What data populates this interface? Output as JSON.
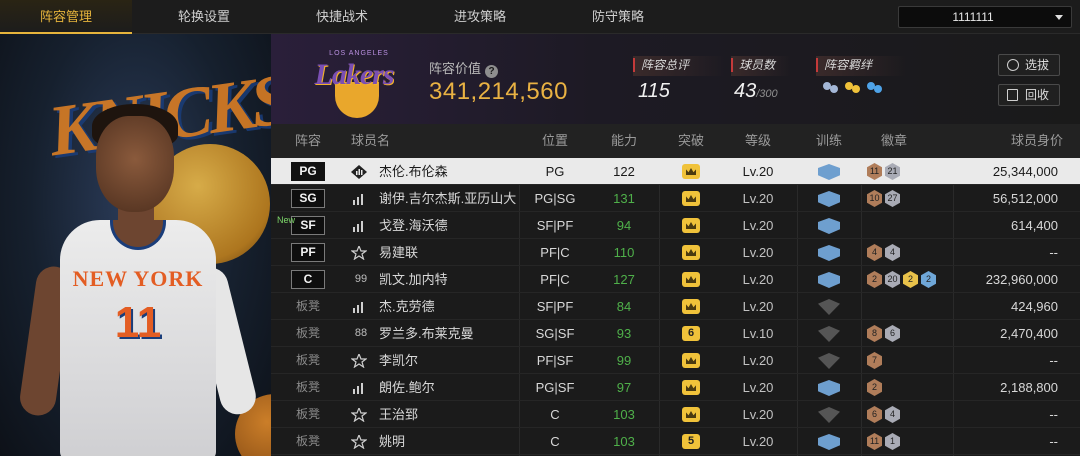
{
  "nav": {
    "tabs": [
      "阵容管理",
      "轮换设置",
      "快捷战术",
      "进攻策略",
      "防守策略"
    ],
    "active_tab": "阵容管理",
    "team_selector": "1111111"
  },
  "colors": {
    "accent": "#e6b43c",
    "value": "#e9b243",
    "green": "#4fb04a"
  },
  "hero": {
    "jersey_text": "NEW YORK",
    "jersey_number": "11",
    "bg_text": "KNICKS"
  },
  "team_header": {
    "logo_text": "Lakers",
    "logo_subtext": "LOS ANGELES",
    "value_label": "阵容价值",
    "value": "341,214,560",
    "stats": [
      {
        "label": "阵容总评",
        "value": "115"
      },
      {
        "label": "球员数",
        "value": "43",
        "sub": "/300"
      },
      {
        "label": "阵容羁绊"
      }
    ],
    "buttons": {
      "select": "选拔",
      "recycle": "回收"
    }
  },
  "table": {
    "headers": [
      "阵容",
      "球员名",
      "位置",
      "能力",
      "突破",
      "等级",
      "训练",
      "徽章",
      "球员身价"
    ],
    "rows": [
      {
        "slot": "PG",
        "starter": true,
        "icon": "diamond",
        "num": "",
        "name": "杰伦.布伦森",
        "position": "PG",
        "rating": "122",
        "breakthrough": "crown",
        "level": "Lv.20",
        "training": "on",
        "badges": [
          {
            "t": "bronze",
            "n": "11"
          },
          {
            "t": "silver",
            "n": "21"
          }
        ],
        "value": "25,344,000"
      },
      {
        "slot": "SG",
        "starter": true,
        "icon": "bars",
        "num": "",
        "name": "谢伊.吉尔杰斯.亚历山大",
        "position": "PG|SG",
        "rating": "131",
        "breakthrough": "crown",
        "level": "Lv.20",
        "training": "on",
        "badges": [
          {
            "t": "bronze",
            "n": "10"
          },
          {
            "t": "silver",
            "n": "27"
          }
        ],
        "value": "56,512,000"
      },
      {
        "slot": "SF",
        "starter": true,
        "new": "New",
        "icon": "bars",
        "num": "",
        "name": "戈登.海沃德",
        "position": "SF|PF",
        "rating": "94",
        "breakthrough": "crown",
        "level": "Lv.20",
        "training": "on",
        "badges": [],
        "value": "614,400"
      },
      {
        "slot": "PF",
        "starter": true,
        "icon": "star",
        "num": "",
        "name": "易建联",
        "position": "PF|C",
        "rating": "110",
        "breakthrough": "crown",
        "level": "Lv.20",
        "training": "on",
        "badges": [
          {
            "t": "bronze",
            "n": "4"
          },
          {
            "t": "silver",
            "n": "4"
          }
        ],
        "value": "--"
      },
      {
        "slot": "C",
        "starter": true,
        "icon": "num",
        "num": "99",
        "name": "凯文.加内特",
        "position": "PF|C",
        "rating": "127",
        "breakthrough": "crown",
        "level": "Lv.20",
        "training": "on",
        "badges": [
          {
            "t": "bronze",
            "n": "2"
          },
          {
            "t": "silver",
            "n": "20"
          },
          {
            "t": "gold",
            "n": "2"
          },
          {
            "t": "blue",
            "n": "2"
          }
        ],
        "value": "232,960,000"
      },
      {
        "slot": "板凳",
        "starter": false,
        "icon": "bars",
        "num": "",
        "name": "杰.克劳德",
        "position": "SF|PF",
        "rating": "84",
        "breakthrough": "crown",
        "level": "Lv.20",
        "training": "off",
        "badges": [],
        "value": "424,960"
      },
      {
        "slot": "板凳",
        "starter": false,
        "icon": "num",
        "num": "88",
        "name": "罗兰多.布莱克曼",
        "position": "SG|SF",
        "rating": "93",
        "breakthrough": "6",
        "level": "Lv.10",
        "training": "off",
        "badges": [
          {
            "t": "bronze",
            "n": "8"
          },
          {
            "t": "silver",
            "n": "6"
          }
        ],
        "value": "2,470,400"
      },
      {
        "slot": "板凳",
        "starter": false,
        "icon": "star",
        "num": "",
        "name": "李凯尔",
        "position": "PF|SF",
        "rating": "99",
        "breakthrough": "crown",
        "level": "Lv.20",
        "training": "off",
        "badges": [
          {
            "t": "bronze",
            "n": "7"
          }
        ],
        "value": "--"
      },
      {
        "slot": "板凳",
        "starter": false,
        "icon": "bars",
        "num": "",
        "name": "朗佐.鲍尔",
        "position": "PG|SF",
        "rating": "97",
        "breakthrough": "crown",
        "level": "Lv.20",
        "training": "on",
        "badges": [
          {
            "t": "bronze",
            "n": "2"
          }
        ],
        "value": "2,188,800"
      },
      {
        "slot": "板凳",
        "starter": false,
        "icon": "star",
        "num": "",
        "name": "王治郅",
        "position": "C",
        "rating": "103",
        "breakthrough": "crown",
        "level": "Lv.20",
        "training": "off",
        "badges": [
          {
            "t": "bronze",
            "n": "6"
          },
          {
            "t": "silver",
            "n": "4"
          }
        ],
        "value": "--"
      },
      {
        "slot": "板凳",
        "starter": false,
        "icon": "star",
        "num": "",
        "name": "姚明",
        "position": "C",
        "rating": "103",
        "breakthrough": "5",
        "level": "Lv.20",
        "training": "on",
        "badges": [
          {
            "t": "bronze",
            "n": "11"
          },
          {
            "t": "silver",
            "n": "1"
          }
        ],
        "value": "--"
      }
    ]
  }
}
